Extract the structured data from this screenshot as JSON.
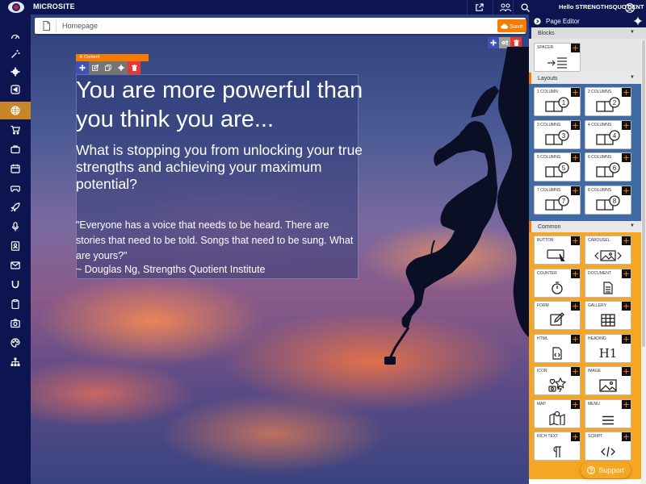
{
  "app": {
    "name": "MICROSITE",
    "greeting": "Hello STRENGTHSQUOTIENT"
  },
  "sidebar": {
    "items": [
      {
        "icon": "dashboard-icon"
      },
      {
        "icon": "magic-icon"
      },
      {
        "icon": "gear-icon"
      },
      {
        "icon": "share-icon"
      },
      {
        "icon": "globe-icon",
        "active": true
      },
      {
        "icon": "cart-icon"
      },
      {
        "icon": "briefcase-icon"
      },
      {
        "icon": "calendar-icon"
      },
      {
        "icon": "gamepad-icon"
      },
      {
        "icon": "rocket-icon"
      },
      {
        "icon": "microphone-icon"
      },
      {
        "icon": "contact-icon"
      },
      {
        "icon": "mail-icon"
      },
      {
        "icon": "magnet-icon"
      },
      {
        "icon": "clipboard-icon"
      },
      {
        "icon": "camera-icon"
      },
      {
        "icon": "palette-icon"
      },
      {
        "icon": "sitemap-icon"
      }
    ]
  },
  "page": {
    "name": "Homepage",
    "save_label": "Save"
  },
  "content": {
    "tag": "Content",
    "heading": "You are more powerful than you think you are...",
    "subheading": "What is stopping you from unlocking your true strengths and achieving your maximum potential?",
    "quote": "\"Everyone has a voice that needs to be heard. There are stories that need to be told. Songs that need to be sung. What are yours?\"",
    "author": "~ Douglas Ng, Strengths Quotient Institute"
  },
  "panel": {
    "title": "Page Editor",
    "blocks": {
      "title": "Blocks",
      "items": [
        "SPACER"
      ]
    },
    "layouts": {
      "title": "Layouts",
      "items": [
        "1 COLUMN",
        "2 COLUMNS",
        "3 COLUMNS",
        "4 COLUMNS",
        "5 COLUMNS",
        "6 COLUMNS",
        "7 COLUMNS",
        "8 COLUMNS"
      ]
    },
    "common": {
      "title": "Common",
      "items": [
        "BUTTON",
        "CAROUSEL",
        "COUNTER",
        "DOCUMENT",
        "FORM",
        "GALLERY",
        "HTML",
        "HEADING",
        "ICON",
        "IMAGE",
        "MAP",
        "MENU",
        "RICH TEXT",
        "SCRIPT"
      ]
    },
    "heading_icon_text": "H1"
  },
  "support_label": "Support",
  "colors": {
    "navy": "#0d1550",
    "orange": "#f57c00",
    "amber": "#f5a623",
    "blue": "#3f6aa5"
  }
}
